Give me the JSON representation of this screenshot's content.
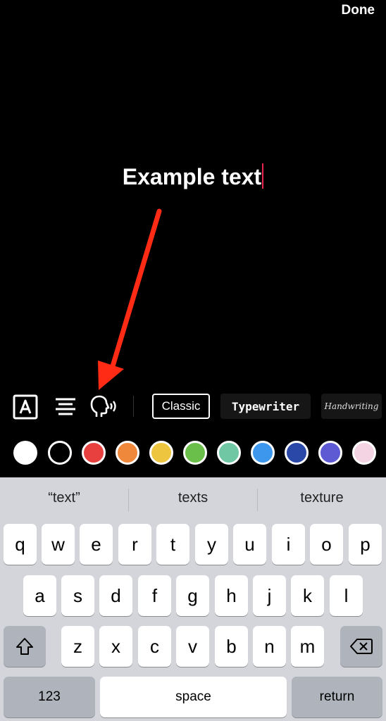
{
  "header": {
    "done_label": "Done"
  },
  "canvas": {
    "text": "Example text"
  },
  "toolbar": {
    "styles": {
      "classic": "Classic",
      "typewriter": "Typewriter",
      "handwriting": "Handwriting"
    }
  },
  "colors": [
    "#ffffff",
    "#000000",
    "#e8403f",
    "#f0883c",
    "#edc53f",
    "#6abf4b",
    "#70c7a4",
    "#3d97ec",
    "#2948a8",
    "#5e5ad4",
    "#f4d3e2"
  ],
  "keyboard": {
    "suggestions": [
      "“text”",
      "texts",
      "texture"
    ],
    "row1": [
      "q",
      "w",
      "e",
      "r",
      "t",
      "y",
      "u",
      "i",
      "o",
      "p"
    ],
    "row2": [
      "a",
      "s",
      "d",
      "f",
      "g",
      "h",
      "j",
      "k",
      "l"
    ],
    "row3": [
      "z",
      "x",
      "c",
      "v",
      "b",
      "n",
      "m"
    ],
    "numbers_label": "123",
    "space_label": "space",
    "return_label": "return"
  }
}
